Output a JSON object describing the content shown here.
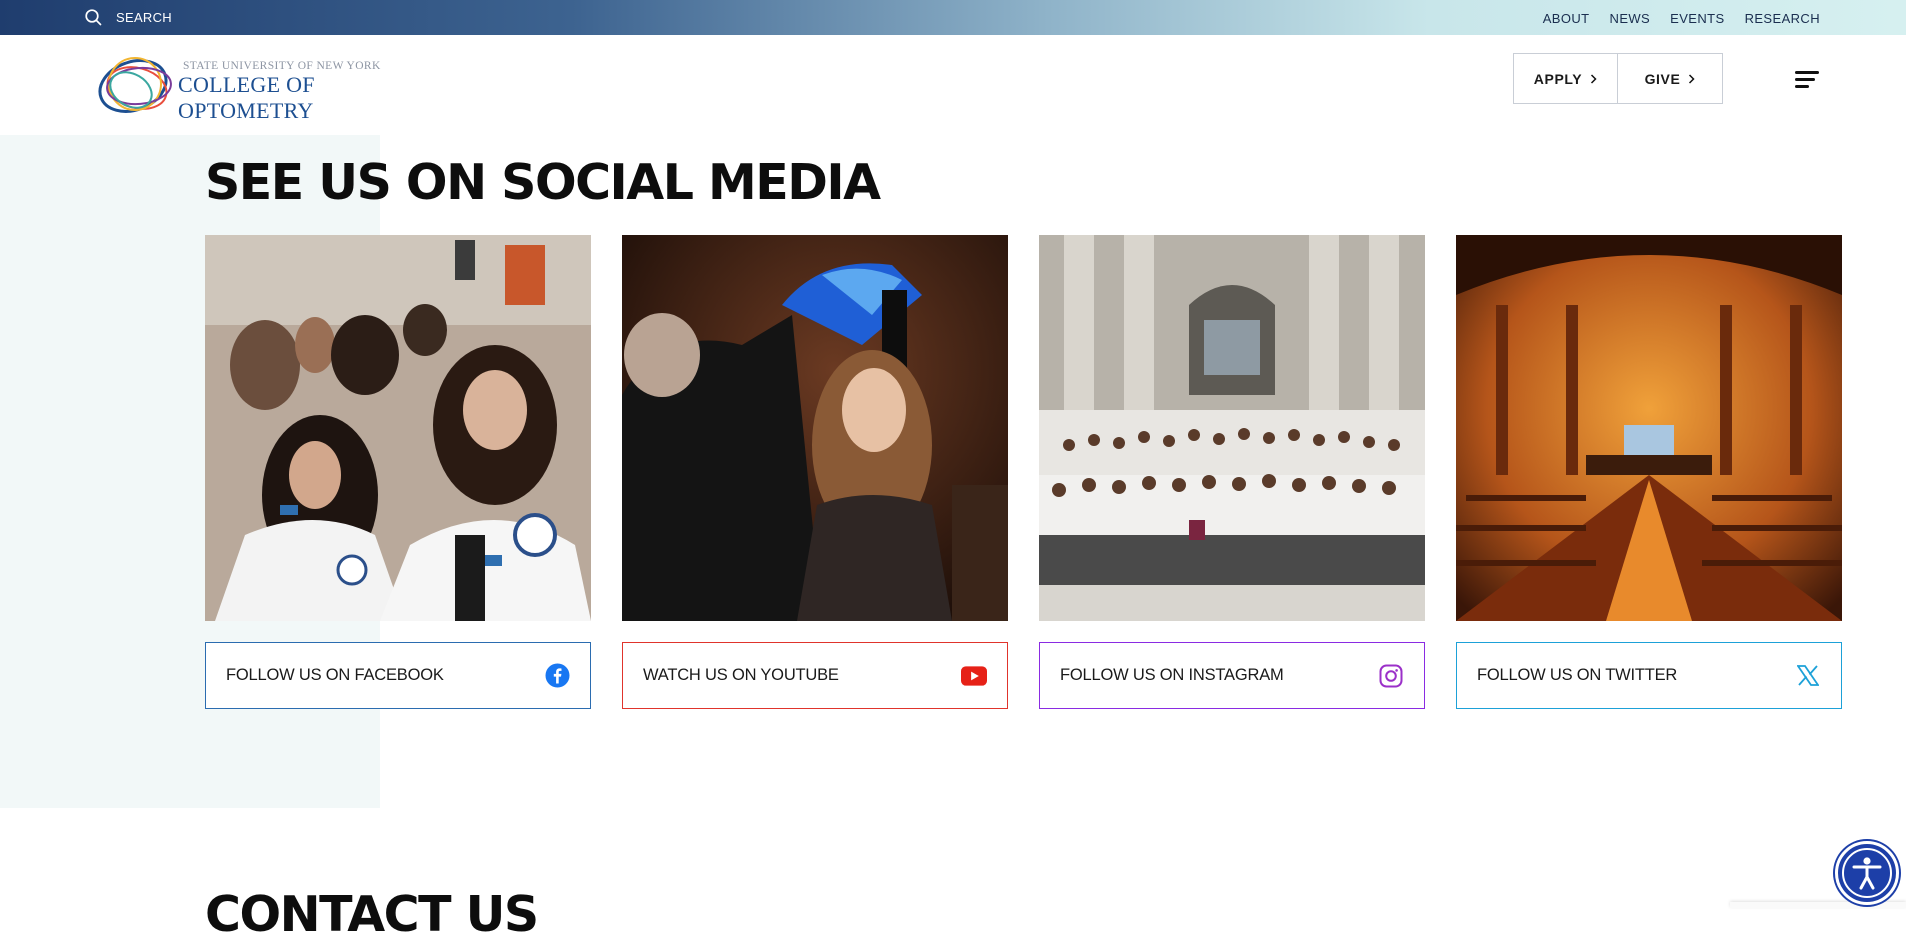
{
  "topbar": {
    "search_label": "SEARCH",
    "links": [
      "ABOUT",
      "NEWS",
      "EVENTS",
      "RESEARCH"
    ]
  },
  "header": {
    "logo_sub": "STATE UNIVERSITY OF NEW YORK",
    "logo_main": "COLLEGE OF OPTOMETRY",
    "apply_label": "APPLY",
    "give_label": "GIVE"
  },
  "social": {
    "title": "SEE US ON SOCIAL MEDIA",
    "cards": [
      {
        "label": "FOLLOW US ON FACEBOOK",
        "icon": "facebook-icon",
        "color": "#2b6cb0",
        "photo": "students-in-white-coats"
      },
      {
        "label": "WATCH US ON YOUTUBE",
        "icon": "youtube-icon",
        "color": "#e0342c",
        "photo": "graduate-hooding-ceremony"
      },
      {
        "label": "FOLLOW US ON INSTAGRAM",
        "icon": "instagram-icon",
        "color": "#8a2be2",
        "photo": "class-group-photo-on-steps"
      },
      {
        "label": "FOLLOW US ON TWITTER",
        "icon": "x-twitter-icon",
        "color": "#1da1d8",
        "photo": "ceremony-hall-interior"
      }
    ]
  },
  "contact": {
    "title": "CONTACT US"
  },
  "colors": {
    "brand_blue": "#1d4f91",
    "accessibility_blue": "#1d3fa8",
    "section_tint": "#f2f8f8"
  }
}
